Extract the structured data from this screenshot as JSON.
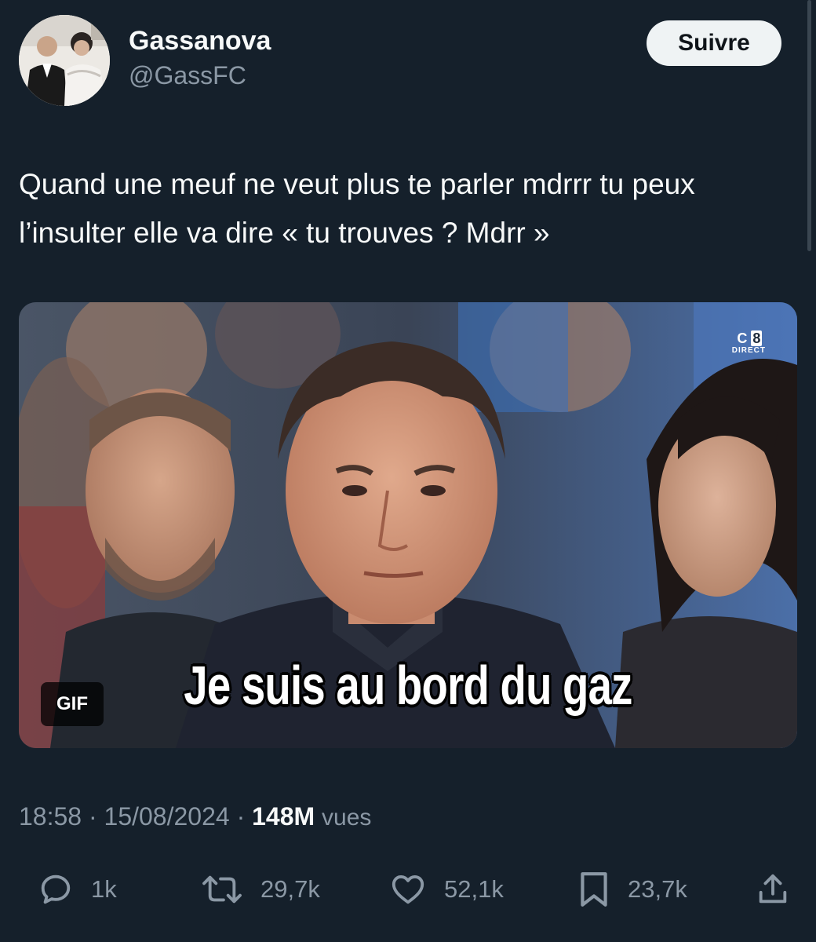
{
  "author": {
    "display_name": "Gassanova",
    "handle": "@GassFC",
    "avatar_icon": "wedding-photo-avatar"
  },
  "follow_button": {
    "label": "Suivre"
  },
  "tweet": {
    "text": "Quand une meuf ne veut plus te parler mdrrr tu peux l’insulter elle va dire « tu trouves ? Mdrr »"
  },
  "media": {
    "type": "gif",
    "badge": "GIF",
    "caption": "Je suis au bord du gaz",
    "channel_logo": {
      "letters": [
        "C",
        "8"
      ],
      "sub": "DIRECT"
    }
  },
  "meta": {
    "time": "18:58",
    "separator": "·",
    "date": "15/08/2024",
    "views_count": "148M",
    "views_label": "vues"
  },
  "actions": {
    "replies": {
      "icon": "reply-icon",
      "count": "1k"
    },
    "retweets": {
      "icon": "retweet-icon",
      "count": "29,7k"
    },
    "likes": {
      "icon": "heart-icon",
      "count": "52,1k"
    },
    "bookmarks": {
      "icon": "bookmark-icon",
      "count": "23,7k"
    },
    "share": {
      "icon": "share-icon"
    }
  },
  "colors": {
    "background": "#15202b",
    "text_primary": "#f7f9f9",
    "text_secondary": "#8b98a5",
    "follow_button_bg": "#eff3f4"
  }
}
